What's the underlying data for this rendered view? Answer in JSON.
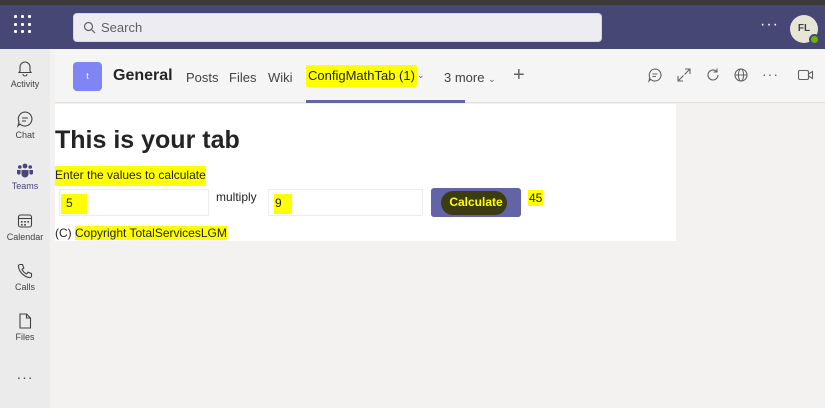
{
  "topbar": {
    "search_placeholder": "Search",
    "more_label": "···",
    "avatar_initials": "FL"
  },
  "rail": {
    "items": [
      {
        "label": "Activity",
        "icon": "bell-icon"
      },
      {
        "label": "Chat",
        "icon": "chat-icon"
      },
      {
        "label": "Teams",
        "icon": "teams-icon"
      },
      {
        "label": "Calendar",
        "icon": "calendar-icon"
      },
      {
        "label": "Calls",
        "icon": "phone-icon"
      },
      {
        "label": "Files",
        "icon": "file-icon"
      }
    ],
    "more_label": "···"
  },
  "channel": {
    "team_avatar_letter": "t",
    "name": "General",
    "tabs": [
      "Posts",
      "Files",
      "Wiki"
    ],
    "active_tab": "ConfigMathTab (1)",
    "more_tabs": "3 more",
    "add_tab": "+"
  },
  "tab_content": {
    "title": "This is your tab",
    "instruction": "Enter the values to calculate",
    "value1": "5",
    "operator_label": "multiply",
    "value2": "9",
    "button_label": "Calculate",
    "result": "45",
    "copyright_prefix": "(C) ",
    "copyright_text": "Copyright TotalServicesLGM"
  },
  "colors": {
    "topbar": "#464775",
    "accent": "#6264a7",
    "highlight": "#ffff00",
    "presence": "#6bb700"
  }
}
